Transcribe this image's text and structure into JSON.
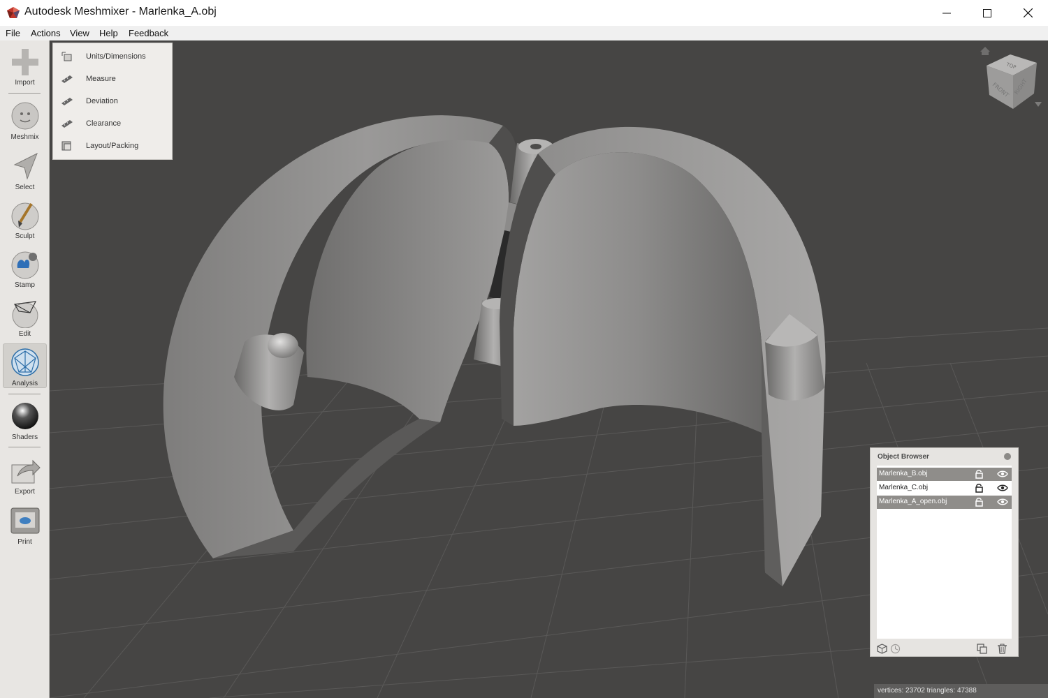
{
  "window": {
    "title": "Autodesk Meshmixer - Marlenka_A.obj",
    "controls": [
      "minimize-icon",
      "maximize-icon",
      "close-icon"
    ]
  },
  "menu": [
    "File",
    "Actions",
    "View",
    "Help",
    "Feedback"
  ],
  "toolbar": {
    "tools": [
      {
        "label": "Import",
        "icon": "import-icon"
      },
      {
        "label": "Meshmix",
        "icon": "meshmix-icon"
      },
      {
        "label": "Select",
        "icon": "select-icon"
      },
      {
        "label": "Sculpt",
        "icon": "sculpt-icon"
      },
      {
        "label": "Stamp",
        "icon": "stamp-icon"
      },
      {
        "label": "Edit",
        "icon": "edit-icon"
      },
      {
        "label": "Analysis",
        "icon": "analysis-icon",
        "active": true
      },
      {
        "label": "Shaders",
        "icon": "shaders-icon"
      },
      {
        "label": "Export",
        "icon": "export-icon"
      },
      {
        "label": "Print",
        "icon": "print-icon"
      }
    ]
  },
  "analysis_menu": {
    "items": [
      {
        "label": "Units/Dimensions",
        "icon": "units-icon"
      },
      {
        "label": "Measure",
        "icon": "ruler-icon"
      },
      {
        "label": "Deviation",
        "icon": "ruler-icon"
      },
      {
        "label": "Clearance",
        "icon": "ruler-icon"
      },
      {
        "label": "Layout/Packing",
        "icon": "layout-icon"
      }
    ]
  },
  "navcube": {
    "faces": [
      "TOP",
      "FRONT",
      "RIGHT"
    ]
  },
  "object_browser": {
    "title": "Object Browser",
    "objects": [
      {
        "name": "Marlenka_B.obj",
        "selected": true
      },
      {
        "name": "Marlenka_C.obj",
        "selected": false
      },
      {
        "name": "Marlenka_A_open.obj",
        "selected": true
      }
    ]
  },
  "status": {
    "text": "vertices: 23702 triangles: 47388"
  },
  "colors": {
    "viewport_bg": "#464544",
    "grid_line": "#5a5958",
    "selection": "#8f8d8a",
    "model": "#8e8d8c"
  }
}
